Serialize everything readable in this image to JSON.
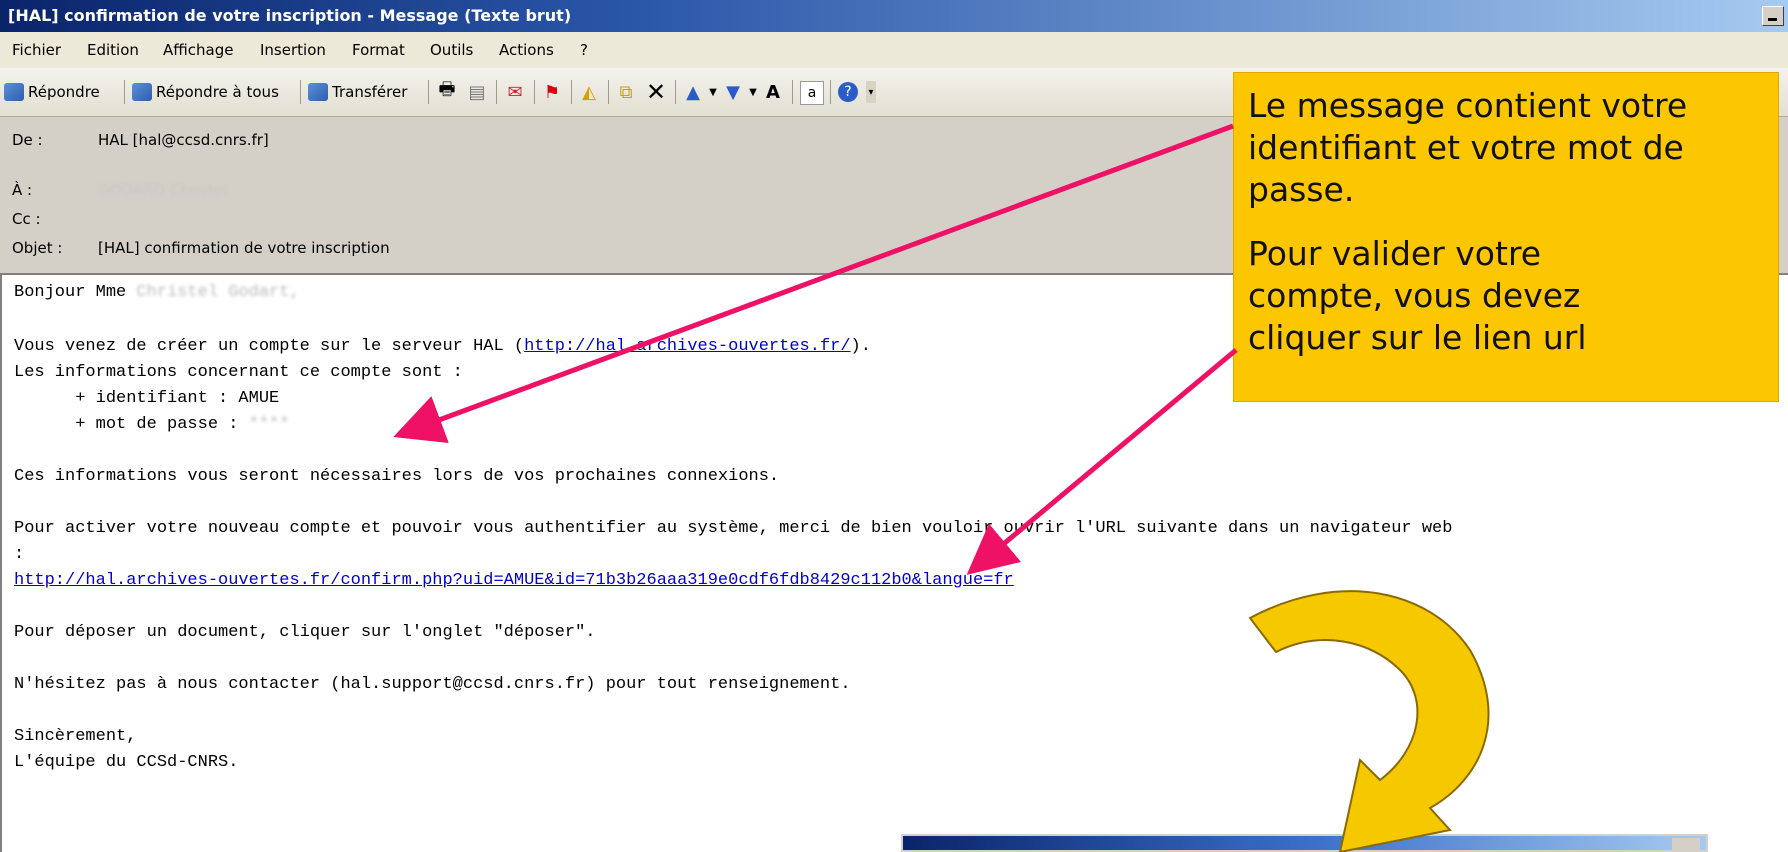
{
  "window": {
    "title": "[HAL] confirmation de votre inscription - Message (Texte brut)"
  },
  "menu": [
    "Fichier",
    "Edition",
    "Affichage",
    "Insertion",
    "Format",
    "Outils",
    "Actions",
    "?"
  ],
  "toolbar": {
    "reply": "Répondre",
    "reply_all": "Répondre à tous",
    "forward": "Transférer"
  },
  "header": {
    "from_label": "De :",
    "from_value": "HAL [hal@ccsd.cnrs.fr]",
    "to_label": "À :",
    "to_value": "GODARD Christel",
    "cc_label": "Cc :",
    "subject_label": "Objet :",
    "subject_value": "[HAL] confirmation de votre inscription"
  },
  "body": {
    "greeting": "Bonjour Mme ",
    "greeting_name": "Christel Godart,",
    "line1_prefix": "Vous venez de créer un compte sur le serveur HAL (",
    "line1_link": "http://hal.archives-ouvertes.fr/",
    "line1_suffix": ").",
    "line2": "Les informations concernant ce compte sont :",
    "ident": "      + identifiant : AMUE",
    "pwd_label": "      + mot de passe : ",
    "pwd_value": "****",
    "line3": "Ces informations vous seront nécessaires lors de vos prochaines connexions.",
    "line4": "Pour activer votre nouveau compte et pouvoir vous authentifier au système, merci de bien vouloir ouvrir l'URL suivante dans un navigateur web",
    "line4b": ":",
    "confirm_link": "http://hal.archives-ouvertes.fr/confirm.php?uid=AMUE&id=71b3b26aaa319e0cdf6fdb8429c112b0&langue=fr",
    "line5": "Pour déposer un document, cliquer sur l'onglet \"déposer\".",
    "line6": "N'hésitez pas à nous contacter (hal.support@ccsd.cnrs.fr) pour tout renseignement.",
    "line7": "Sincèrement,",
    "line8": "L'équipe du CCSd-CNRS."
  },
  "callout": {
    "l1": "Le message contient votre",
    "l2": "identifiant et votre mot de",
    "l3": "passe.",
    "l4": "Pour  valider votre",
    "l5": "compte, vous devez",
    "l6": "cliquer sur le lien url"
  },
  "colors": {
    "callout": "#fcc600",
    "arrow": "#ee1166",
    "curved_arrow": "#f5c800"
  }
}
